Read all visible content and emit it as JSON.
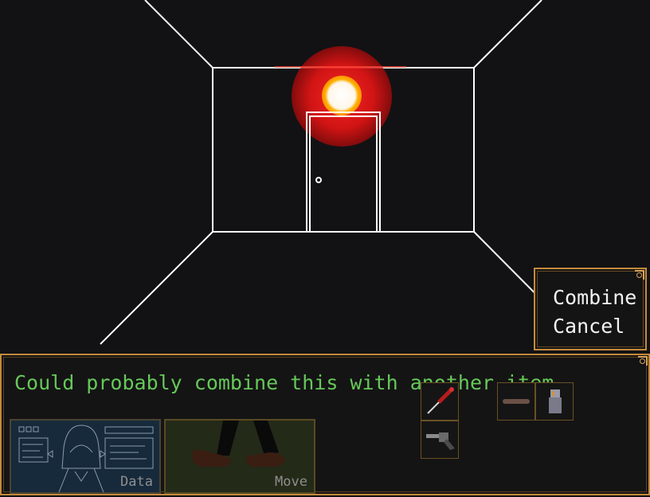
{
  "menu": {
    "items": [
      {
        "label": "Combine"
      },
      {
        "label": "Cancel"
      }
    ]
  },
  "message": {
    "text": "Could probably combine this with another item."
  },
  "actions": {
    "data_label": "Data",
    "move_label": "Move"
  },
  "inventory": {
    "items": [
      {
        "icon": "screwdriver-icon"
      },
      {
        "icon": "revolver-icon"
      },
      {
        "icon": "cigar-icon"
      },
      {
        "icon": "lighter-icon"
      }
    ]
  },
  "colors": {
    "border": "#c48a3a",
    "message_text": "#66c85a",
    "menu_text": "#f2f2f2",
    "background": "#121214",
    "light_red": "#e01818"
  }
}
